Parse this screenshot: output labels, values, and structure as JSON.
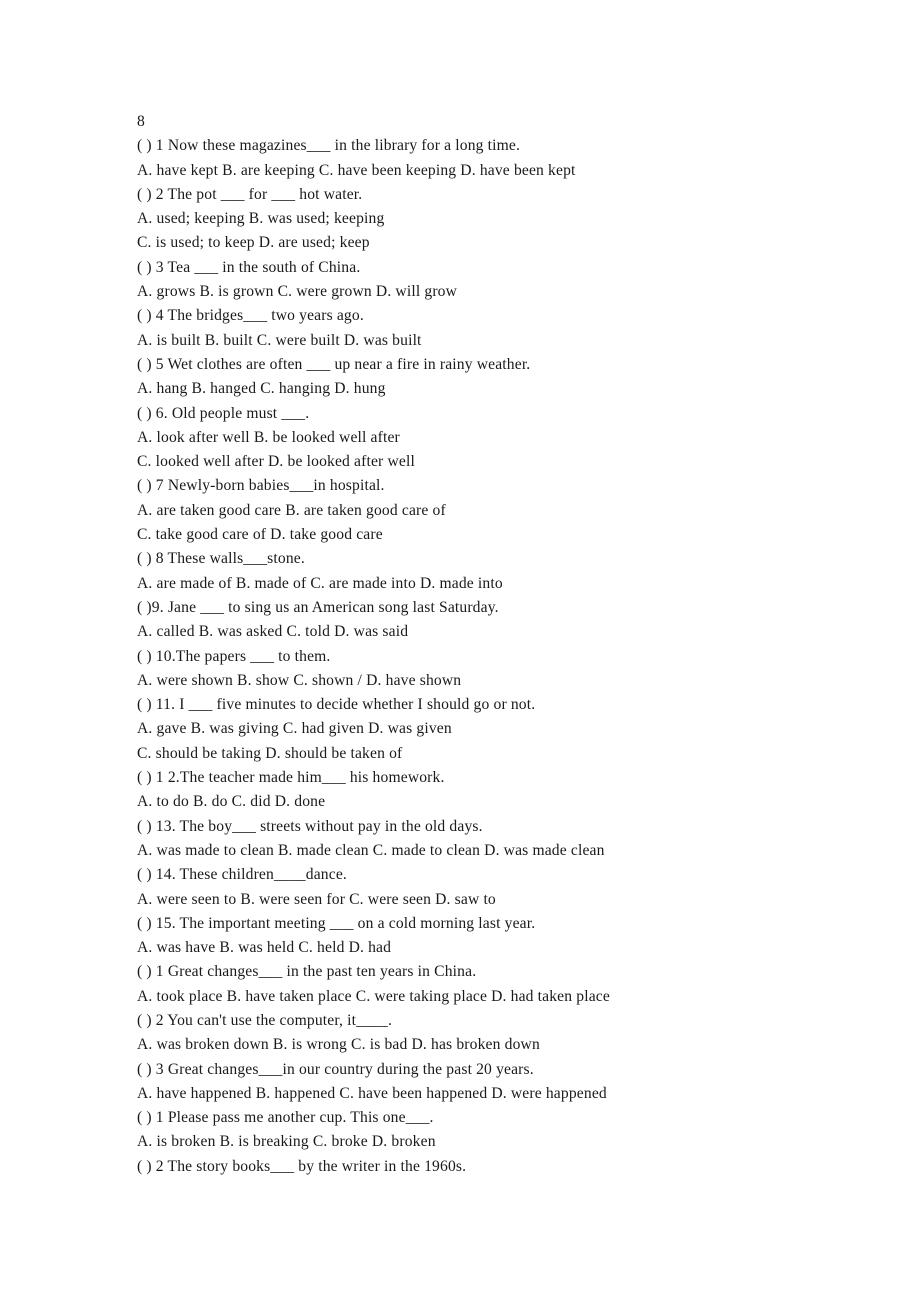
{
  "document": {
    "page_number_label": "8",
    "lines": [
      "( ) 1 Now these magazines___ in the library for a long time.",
      "A. have kept B. are keeping C. have been keeping D. have been kept",
      "( ) 2 The pot ___ for ___ hot water.",
      "A. used; keeping B. was used; keeping",
      "C. is used; to keep D. are used; keep",
      "( ) 3 Tea ___ in the south of China.",
      "A. grows B. is grown C. were grown D. will grow",
      "( ) 4 The bridges___ two years ago.",
      "A. is built B. built C. were built D. was built",
      "( ) 5 Wet clothes are often ___ up near a fire in rainy weather.",
      "A. hang B. hanged C. hanging D. hung",
      "( ) 6. Old people must ___.",
      "A. look after well B. be looked well after",
      "C. looked well after D. be looked after well",
      "( ) 7 Newly-born babies___in hospital.",
      "A. are taken good care B. are taken good care of",
      "C. take good care of D. take good care",
      "( ) 8 These walls___stone.",
      "A. are made of B. made of C. are made into D. made into",
      "( )9. Jane ___ to sing us an American song last Saturday.",
      "A. called B. was asked C. told D. was said",
      "( ) 10.The papers ___ to them.",
      "A. were shown B. show C. shown / D. have shown",
      "( ) 11. I ___ five minutes to decide whether I should go or not.",
      "A. gave B. was giving C. had given D. was given",
      "C. should be taking D. should be taken of",
      "( ) 1 2.The teacher made him___ his homework.",
      "A. to do B. do C. did D. done",
      "( ) 13. The boy___ streets without pay in the old days.",
      "A. was made to clean B. made clean C. made to clean D. was made clean",
      "( ) 14. These children____dance.",
      "A. were seen to B. were seen for C. were seen D. saw to",
      "( ) 15. The important meeting ___ on a cold morning last year.",
      "A. was have B. was held C. held D. had",
      "( ) 1 Great changes___ in the past ten years in China.",
      "A. took place B. have taken place C. were taking place D. had taken place",
      "( ) 2 You can't use the computer, it____.",
      "A. was broken down B. is wrong C. is bad D. has broken down",
      "( ) 3 Great changes___in our country during the past 20 years.",
      "A. have happened B. happened C. have been happened D. were happened",
      "( ) 1 Please pass me another cup. This one___.",
      "A. is broken B. is breaking C. broke D. broken",
      "( ) 2 The story books___ by the writer in the 1960s."
    ]
  }
}
